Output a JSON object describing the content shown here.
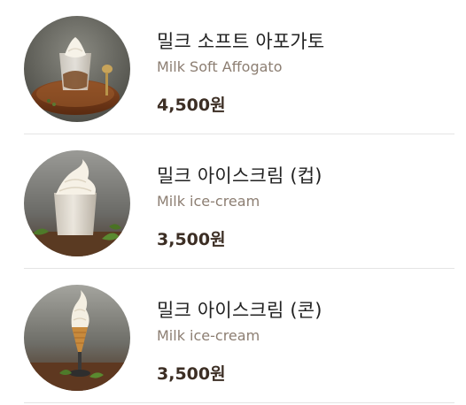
{
  "menu": {
    "items": [
      {
        "name": "밀크 소프트 아포가토",
        "name_en": "Milk Soft Affogato",
        "price": "4,500원"
      },
      {
        "name": "밀크 아이스크림 (컵)",
        "name_en": "Milk ice-cream",
        "price": "3,500원"
      },
      {
        "name": "밀크 아이스크림 (콘)",
        "name_en": "Milk ice-cream",
        "price": "3,500원"
      }
    ]
  },
  "colors": {
    "name_text": "#222222",
    "english_text": "#8c7e72",
    "price_text": "#3c2e24",
    "divider": "#e4e4e4"
  }
}
